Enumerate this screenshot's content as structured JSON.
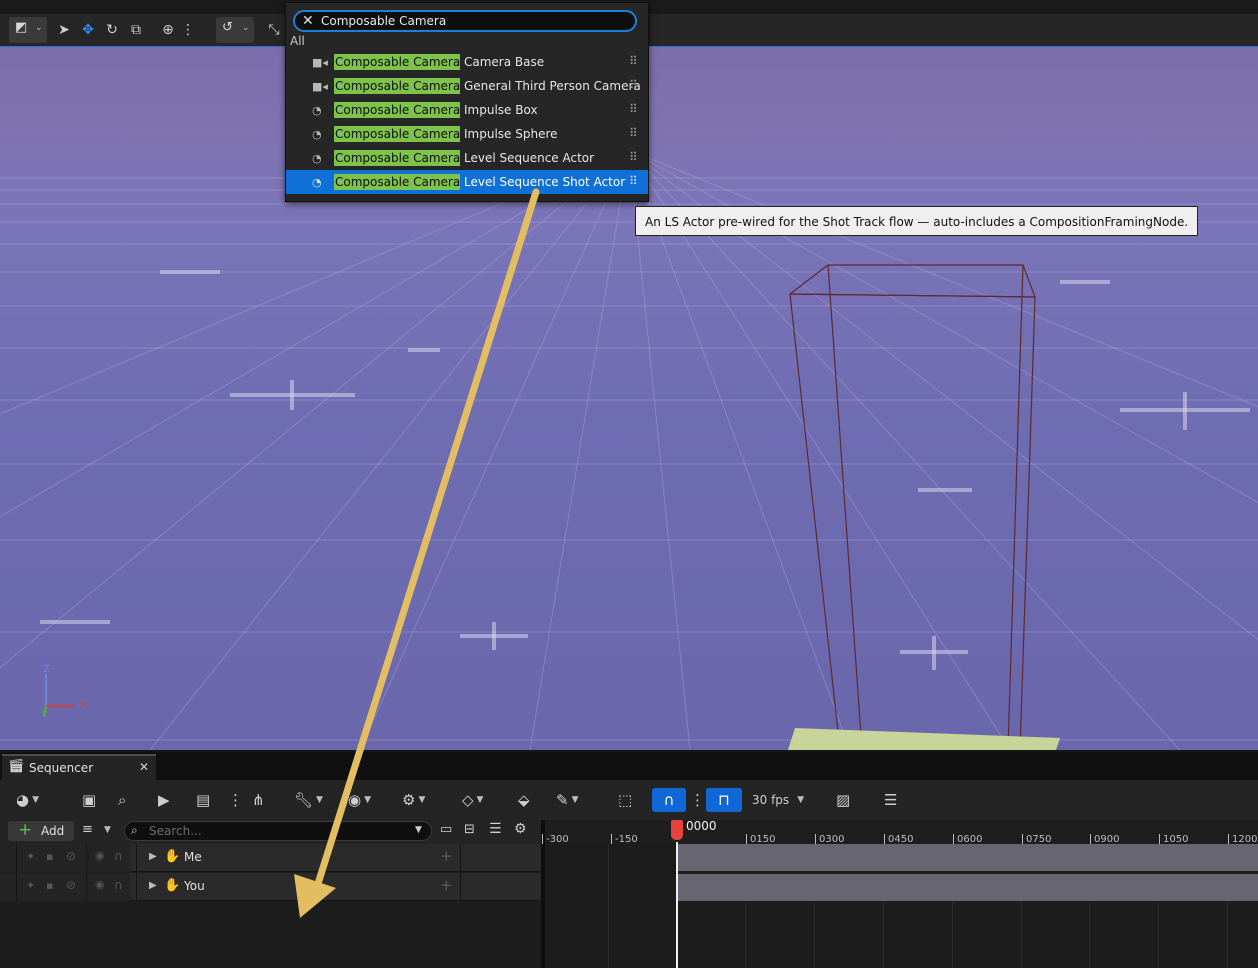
{
  "popup": {
    "search_value": "Composable Camera",
    "category": "All",
    "items": [
      {
        "highlight": "Composable Camera",
        "rest": "Camera Base",
        "icon": "camera-icon"
      },
      {
        "highlight": "Composable Camera",
        "rest": "General Third Person Camera",
        "icon": "camera-icon"
      },
      {
        "highlight": "Composable Camera",
        "rest": "Impulse Box",
        "icon": "actor-icon"
      },
      {
        "highlight": "Composable Camera",
        "rest": "Impulse Sphere",
        "icon": "actor-icon"
      },
      {
        "highlight": "Composable Camera",
        "rest": "Level Sequence Actor",
        "icon": "actor-icon"
      },
      {
        "highlight": "Composable Camera",
        "rest": "Level Sequence Shot Actor",
        "icon": "actor-icon",
        "selected": true
      }
    ]
  },
  "tooltip": "An LS Actor pre-wired for the Shot Track flow — auto-includes a CompositionFramingNode.",
  "viewport": {
    "axis_z": "Z",
    "axis_x": "X",
    "axis_y": "Y"
  },
  "sequencer": {
    "tab_title": "Sequencer",
    "fps_label": "30 fps",
    "add_label": "Add",
    "search_placeholder": "Search...",
    "tracks": [
      {
        "name": "Me"
      },
      {
        "name": "You"
      }
    ],
    "playhead_label": "0000",
    "ruler_ticks": [
      "-300",
      "-150",
      "0150",
      "0300",
      "0450",
      "0600",
      "0750",
      "0900",
      "1050",
      "1200"
    ]
  },
  "colors": {
    "accent": "#0f70d8",
    "highlight": "#7dc24a",
    "playhead": "#e8413c",
    "arrow": "#e3bd62"
  }
}
